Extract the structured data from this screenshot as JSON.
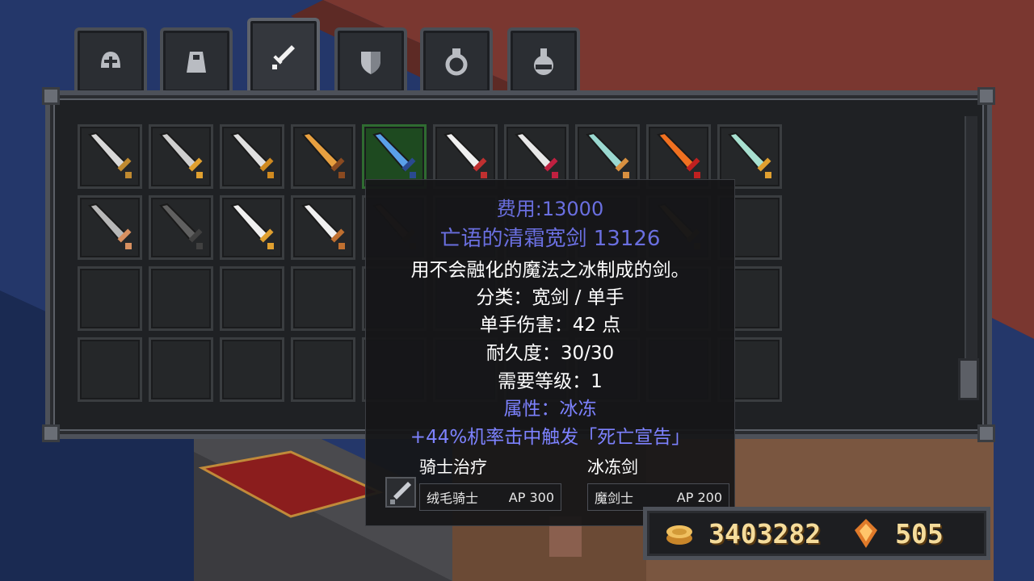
{
  "tabs": [
    {
      "icon": "helmet-icon",
      "active": false
    },
    {
      "icon": "cloak-icon",
      "active": false
    },
    {
      "icon": "sword-icon",
      "active": true
    },
    {
      "icon": "shield-icon",
      "active": false
    },
    {
      "icon": "ring-icon",
      "active": false
    },
    {
      "icon": "potion-icon",
      "active": false
    }
  ],
  "inventory": {
    "row1": [
      "steel-sword-icon",
      "gilded-sword-icon",
      "short-sword-icon",
      "golden-dagger-icon",
      "frost-broadsword-icon",
      "white-blade-icon",
      "crimson-cleaver-icon",
      "thin-rapier-icon",
      "flame-sword-icon",
      "jade-sword-icon"
    ],
    "row2": [
      "mace-icon",
      "bow-icon",
      "crossbow-icon",
      "spear-icon",
      "dark-spear-icon",
      "",
      "",
      "",
      "scythe-icon",
      ""
    ],
    "selected_index": 4
  },
  "tooltip": {
    "cost": "费用:13000",
    "name": "亡语的清霜宽剑 13126",
    "description": "用不会融化的魔法之冰制成的剑。",
    "category": "分类：宽剑 / 单手",
    "damage": "单手伤害：42 点",
    "durability": "耐久度：30/30",
    "level": "需要等级：1",
    "attribute": "属性：冰冻",
    "effect": "+44%机率击中触发「死亡宣告」",
    "skills": [
      {
        "title": "骑士治疗",
        "class": "绒毛骑士",
        "ap": "AP 300"
      },
      {
        "title": "冰冻剑",
        "class": "魔剑士",
        "ap": "AP 200"
      }
    ]
  },
  "currency": {
    "gold": "3403282",
    "gems": "505"
  }
}
